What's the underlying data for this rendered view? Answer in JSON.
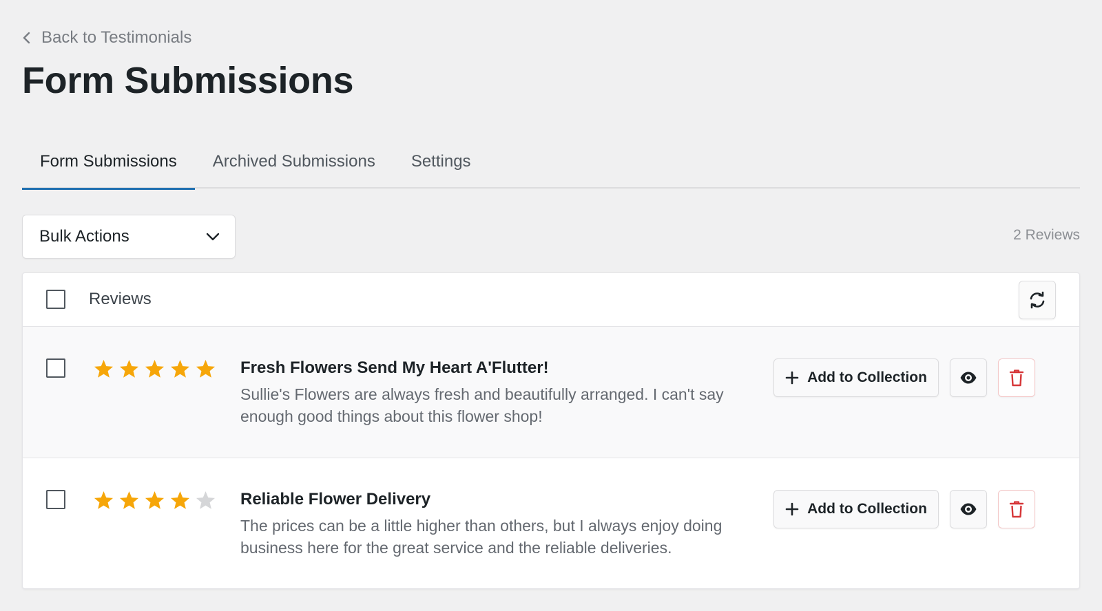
{
  "nav": {
    "back_label": "Back to Testimonials"
  },
  "page": {
    "title": "Form Submissions"
  },
  "tabs": [
    {
      "label": "Form Submissions",
      "active": true
    },
    {
      "label": "Archived Submissions",
      "active": false
    },
    {
      "label": "Settings",
      "active": false
    }
  ],
  "toolbar": {
    "bulk_actions_label": "Bulk Actions",
    "review_count": "2 Reviews"
  },
  "table": {
    "header_label": "Reviews"
  },
  "reviews": [
    {
      "title": "Fresh Flowers Send My Heart A'Flutter!",
      "body": "Sullie's Flowers are always fresh and beautifully arranged. I can't say enough good things about this flower shop!",
      "rating": 5,
      "max_rating": 5,
      "add_label": "Add to Collection"
    },
    {
      "title": "Reliable Flower Delivery",
      "body": "The prices can be a little higher than others, but I always enjoy doing business here for the great service and the reliable deliveries.",
      "rating": 4,
      "max_rating": 5,
      "add_label": "Add to Collection"
    }
  ],
  "colors": {
    "accent": "#2271b1",
    "star_filled": "#f6a609",
    "star_empty": "#d5d6d8",
    "delete": "#d63638"
  },
  "icons": {
    "back": "chevron-left-icon",
    "dropdown": "chevron-down-icon",
    "refresh": "refresh-icon",
    "add": "plus-icon",
    "view": "eye-icon",
    "delete": "trash-icon",
    "star": "star-icon"
  }
}
